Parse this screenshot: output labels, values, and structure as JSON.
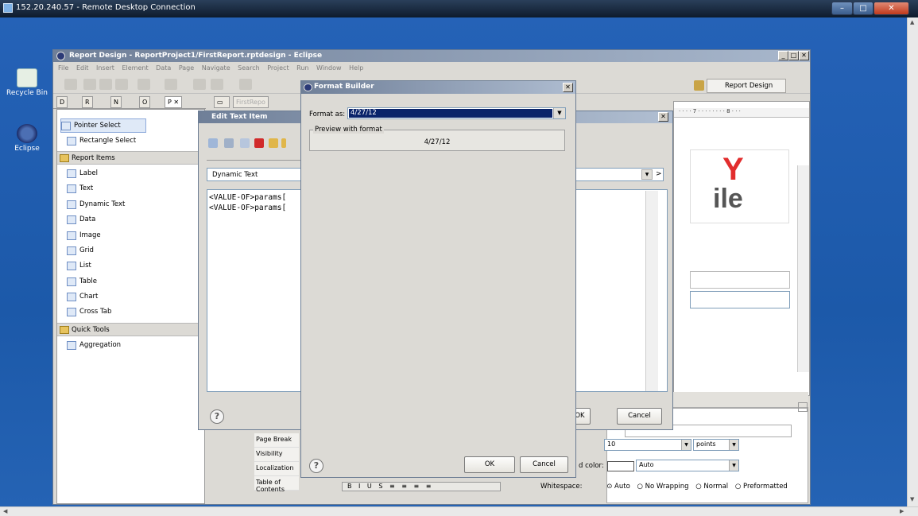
{
  "rdp": {
    "title": "152.20.240.57 - Remote Desktop Connection"
  },
  "desktop": {
    "icons": [
      {
        "label": "Recycle Bin"
      },
      {
        "label": "Eclipse"
      }
    ]
  },
  "eclipse": {
    "title": "Report Design - ReportProject1/FirstReport.rptdesign - Eclipse",
    "menu": [
      "File",
      "Edit",
      "Insert",
      "Element",
      "Data",
      "Page",
      "Navigate",
      "Search",
      "Project",
      "Run",
      "Window",
      "Help"
    ],
    "perspective": "Report Design",
    "palette_tabs": [
      "D",
      "R",
      "N",
      "O",
      "P"
    ],
    "palette": {
      "tools": [
        "Pointer Select",
        "Rectangle Select"
      ],
      "report_items_header": "Report Items",
      "report_items": [
        "Label",
        "Text",
        "Dynamic Text",
        "Data",
        "Image",
        "Grid",
        "List",
        "Table",
        "Chart",
        "Cross Tab"
      ],
      "quick_tools_header": "Quick Tools",
      "quick_tools": [
        "Aggregation"
      ]
    },
    "editor_tab": "FirstRepo",
    "properties": {
      "list": [
        "Page Break",
        "Visibility",
        "Localization",
        "Table of Contents"
      ],
      "font_size": "10",
      "font_unit": "points",
      "bg_color_label": "d color:",
      "bg_color_value": "Auto",
      "whitespace_label": "Whitespace:",
      "whitespace_options": [
        "Auto",
        "No Wrapping",
        "Normal",
        "Preformatted"
      ]
    }
  },
  "edit_text": {
    "title": "Edit Text Item",
    "type_value": "Dynamic Text",
    "lines": [
      "<VALUE-OF>params[",
      "<VALUE-OF>params["
    ],
    "ok": "OK",
    "cancel": "Cancel"
  },
  "format_builder": {
    "title": "Format Builder",
    "format_label": "Format as:",
    "format_value": "4/27/12",
    "preview_label": "Preview with format",
    "preview_value": "4/27/12",
    "ok": "OK",
    "cancel": "Cancel"
  }
}
